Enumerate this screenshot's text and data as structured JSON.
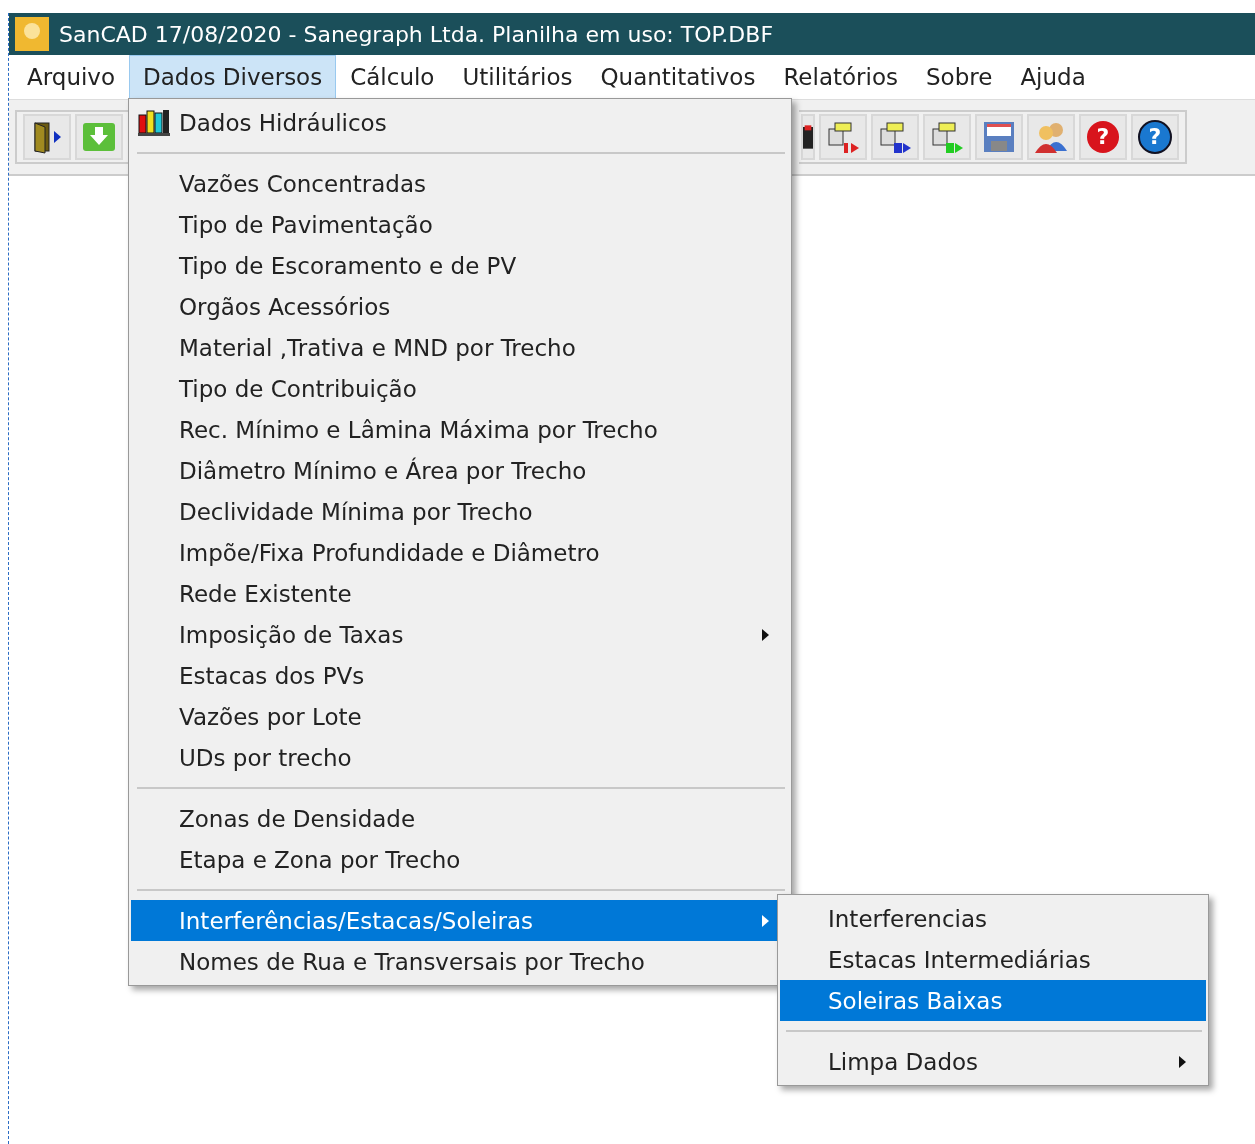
{
  "window": {
    "title": "SanCAD 17/08/2020 - Sanegraph Ltda. Planilha em uso: TOP.DBF"
  },
  "menu_bar": [
    {
      "label": "Arquivo",
      "selected": false
    },
    {
      "label": "Dados Diversos",
      "selected": true
    },
    {
      "label": "Cálculo",
      "selected": false
    },
    {
      "label": "Utilitários",
      "selected": false
    },
    {
      "label": "Quantitativos",
      "selected": false
    },
    {
      "label": "Relatórios",
      "selected": false
    },
    {
      "label": "Sobre",
      "selected": false
    },
    {
      "label": "Ajuda",
      "selected": false
    }
  ],
  "toolbar": {
    "left": [
      {
        "kind": "door"
      },
      {
        "kind": "download"
      }
    ],
    "right": [
      {
        "kind": "partial"
      },
      {
        "kind": "doc1"
      },
      {
        "kind": "doc2"
      },
      {
        "kind": "doc3"
      },
      {
        "kind": "save"
      },
      {
        "kind": "users"
      },
      {
        "kind": "help_red",
        "glyph": "?"
      },
      {
        "kind": "help_blue",
        "glyph": "?"
      }
    ]
  },
  "dropdown": [
    {
      "kind": "item",
      "label": "Dados Hidráulicos",
      "icon": true,
      "submenu": false,
      "selected": false
    },
    {
      "kind": "separator"
    },
    {
      "kind": "item",
      "label": "Vazões Concentradas",
      "submenu": false,
      "selected": false
    },
    {
      "kind": "item",
      "label": "Tipo de Pavimentação",
      "submenu": false,
      "selected": false
    },
    {
      "kind": "item",
      "label": "Tipo de Escoramento e de PV",
      "submenu": false,
      "selected": false
    },
    {
      "kind": "item",
      "label": "Orgãos Acessórios",
      "submenu": false,
      "selected": false
    },
    {
      "kind": "item",
      "label": "Material ,Trativa e MND por Trecho",
      "submenu": false,
      "selected": false
    },
    {
      "kind": "item",
      "label": "Tipo de Contribuição",
      "submenu": false,
      "selected": false
    },
    {
      "kind": "item",
      "label": "Rec. Mínimo e Lâmina Máxima por Trecho",
      "submenu": false,
      "selected": false
    },
    {
      "kind": "item",
      "label": "Diâmetro Mínimo e Área por Trecho",
      "submenu": false,
      "selected": false
    },
    {
      "kind": "item",
      "label": "Declividade Mínima por Trecho",
      "submenu": false,
      "selected": false
    },
    {
      "kind": "item",
      "label": "Impõe/Fixa Profundidade e Diâmetro",
      "submenu": false,
      "selected": false
    },
    {
      "kind": "item",
      "label": "Rede Existente",
      "submenu": false,
      "selected": false
    },
    {
      "kind": "item",
      "label": "Imposição de Taxas",
      "submenu": true,
      "selected": false
    },
    {
      "kind": "item",
      "label": "Estacas dos PVs",
      "submenu": false,
      "selected": false
    },
    {
      "kind": "item",
      "label": "Vazões por Lote",
      "submenu": false,
      "selected": false
    },
    {
      "kind": "item",
      "label": "UDs  por trecho",
      "submenu": false,
      "selected": false
    },
    {
      "kind": "separator"
    },
    {
      "kind": "item",
      "label": "Zonas de Densidade",
      "submenu": false,
      "selected": false
    },
    {
      "kind": "item",
      "label": "Etapa e Zona por Trecho",
      "submenu": false,
      "selected": false
    },
    {
      "kind": "separator"
    },
    {
      "kind": "item",
      "label": "Interferências/Estacas/Soleiras",
      "submenu": true,
      "selected": true
    },
    {
      "kind": "item",
      "label": "Nomes de Rua e Transversais por Trecho",
      "submenu": false,
      "selected": false
    }
  ],
  "submenu": [
    {
      "kind": "item",
      "label": "Interferencias",
      "submenu": false,
      "selected": false
    },
    {
      "kind": "item",
      "label": "Estacas Intermediárias",
      "submenu": false,
      "selected": false
    },
    {
      "kind": "item",
      "label": "Soleiras Baixas",
      "submenu": false,
      "selected": true
    },
    {
      "kind": "separator"
    },
    {
      "kind": "item",
      "label": "Limpa Dados",
      "submenu": true,
      "selected": false
    }
  ]
}
